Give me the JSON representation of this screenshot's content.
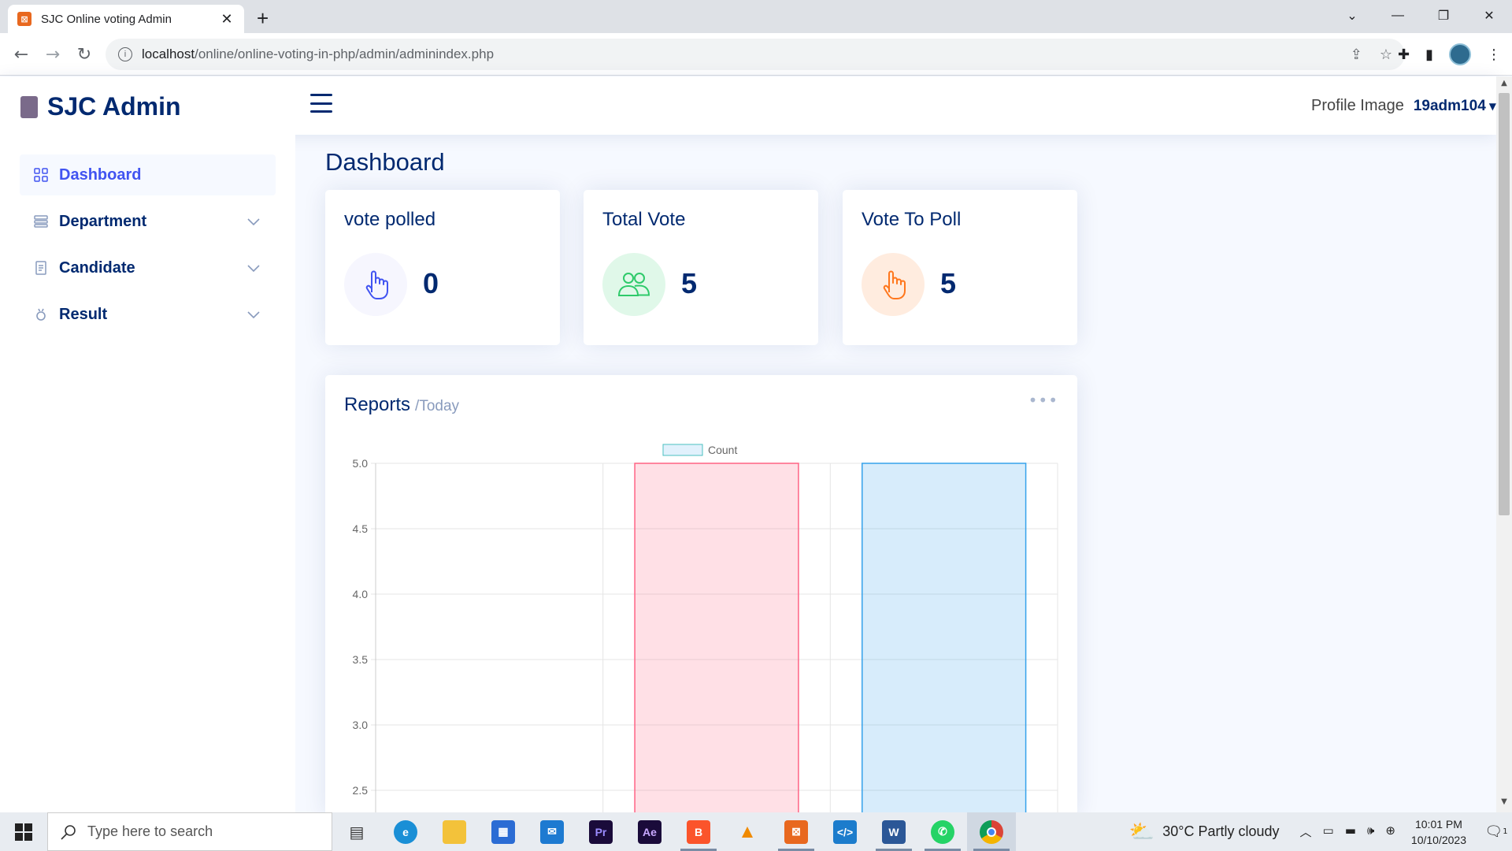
{
  "browser": {
    "tab_title": "SJC Online voting Admin",
    "url_host": "localhost",
    "url_path": "/online/online-voting-in-php/admin/adminindex.php"
  },
  "header": {
    "brand": "SJC Admin",
    "profile_image_alt": "Profile Image",
    "username": "19adm104"
  },
  "sidebar": {
    "items": [
      {
        "label": "Dashboard",
        "icon": "grid-icon",
        "active": true
      },
      {
        "label": "Department",
        "icon": "menu-list-icon",
        "expandable": true
      },
      {
        "label": "Candidate",
        "icon": "document-icon",
        "expandable": true
      },
      {
        "label": "Result",
        "icon": "medal-icon",
        "expandable": true
      }
    ]
  },
  "main": {
    "title": "Dashboard",
    "cards": [
      {
        "title": "vote polled",
        "value": "0",
        "icon": "hand-pointer-icon",
        "color": "#4154f1",
        "bg": "#f6f6fe"
      },
      {
        "title": "Total Vote",
        "value": "5",
        "icon": "people-icon",
        "color": "#2eca6a",
        "bg": "#e0f8e9"
      },
      {
        "title": "Vote To Poll",
        "value": "5",
        "icon": "hand-pointer-icon",
        "color": "#ff771d",
        "bg": "#ffecdf"
      }
    ],
    "report": {
      "title": "Reports",
      "subtitle": "/Today"
    }
  },
  "chart_data": {
    "type": "bar",
    "categories": [
      "",
      "",
      ""
    ],
    "values": [
      0,
      5,
      5
    ],
    "legend": "Count",
    "legend_position": "top",
    "ylim": [
      2.5,
      5.0
    ],
    "yticks": [
      "5.0",
      "4.5",
      "4.0",
      "3.5",
      "3.0",
      "2.5"
    ],
    "bar_colors": [
      "#36a2eb",
      "#ff6384",
      "#36a2eb"
    ],
    "grid": true
  },
  "taskbar": {
    "search_placeholder": "Type here to search",
    "weather": "30°C  Partly cloudy",
    "time": "10:01 PM",
    "date": "10/10/2023",
    "notification_count": "1"
  }
}
